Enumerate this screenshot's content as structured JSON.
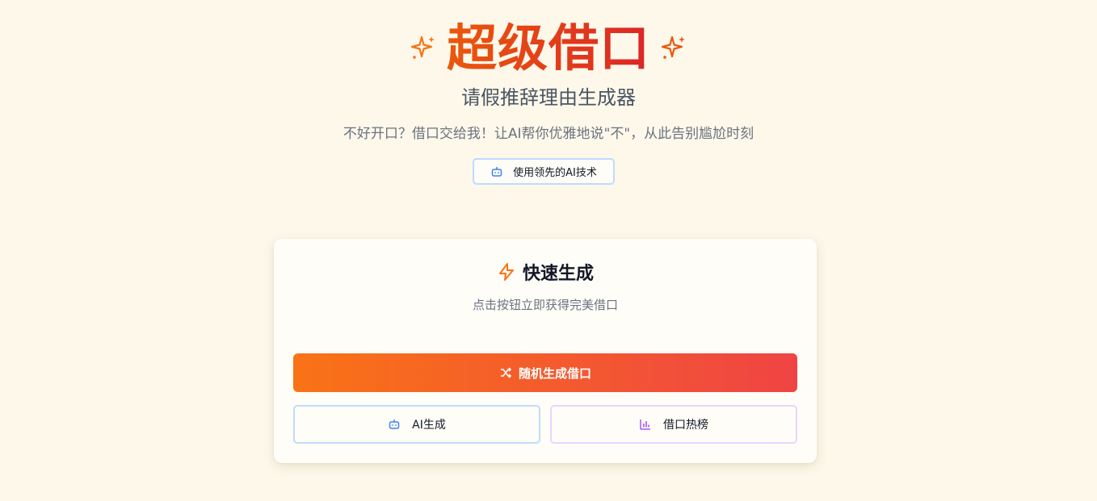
{
  "hero": {
    "title": "超级借口",
    "subtitle": "请假推辞理由生成器",
    "tagline": "不好开口？借口交给我！让AI帮你优雅地说\"不\"，从此告别尴尬时刻",
    "badge_label": "使用领先的AI技术",
    "badge_icon": "bot-icon",
    "title_icon": "sparkles-icon"
  },
  "card": {
    "title": "快速生成",
    "title_icon": "zap-icon",
    "description": "点击按钮立即获得完美借口",
    "primary_button": {
      "label": "随机生成借口",
      "icon": "shuffle-icon"
    },
    "ai_button": {
      "label": "AI生成",
      "icon": "bot-icon"
    },
    "hot_button": {
      "label": "借口热榜",
      "icon": "bar-chart-icon"
    }
  },
  "colors": {
    "background": "#fdf8ea",
    "accent_orange": "#f97316",
    "accent_red": "#ef4444",
    "badge_border": "#bfdbfe",
    "hot_border": "#e9d5ff",
    "ai_icon": "#3b82f6",
    "chart_icon": "#a855f7"
  }
}
